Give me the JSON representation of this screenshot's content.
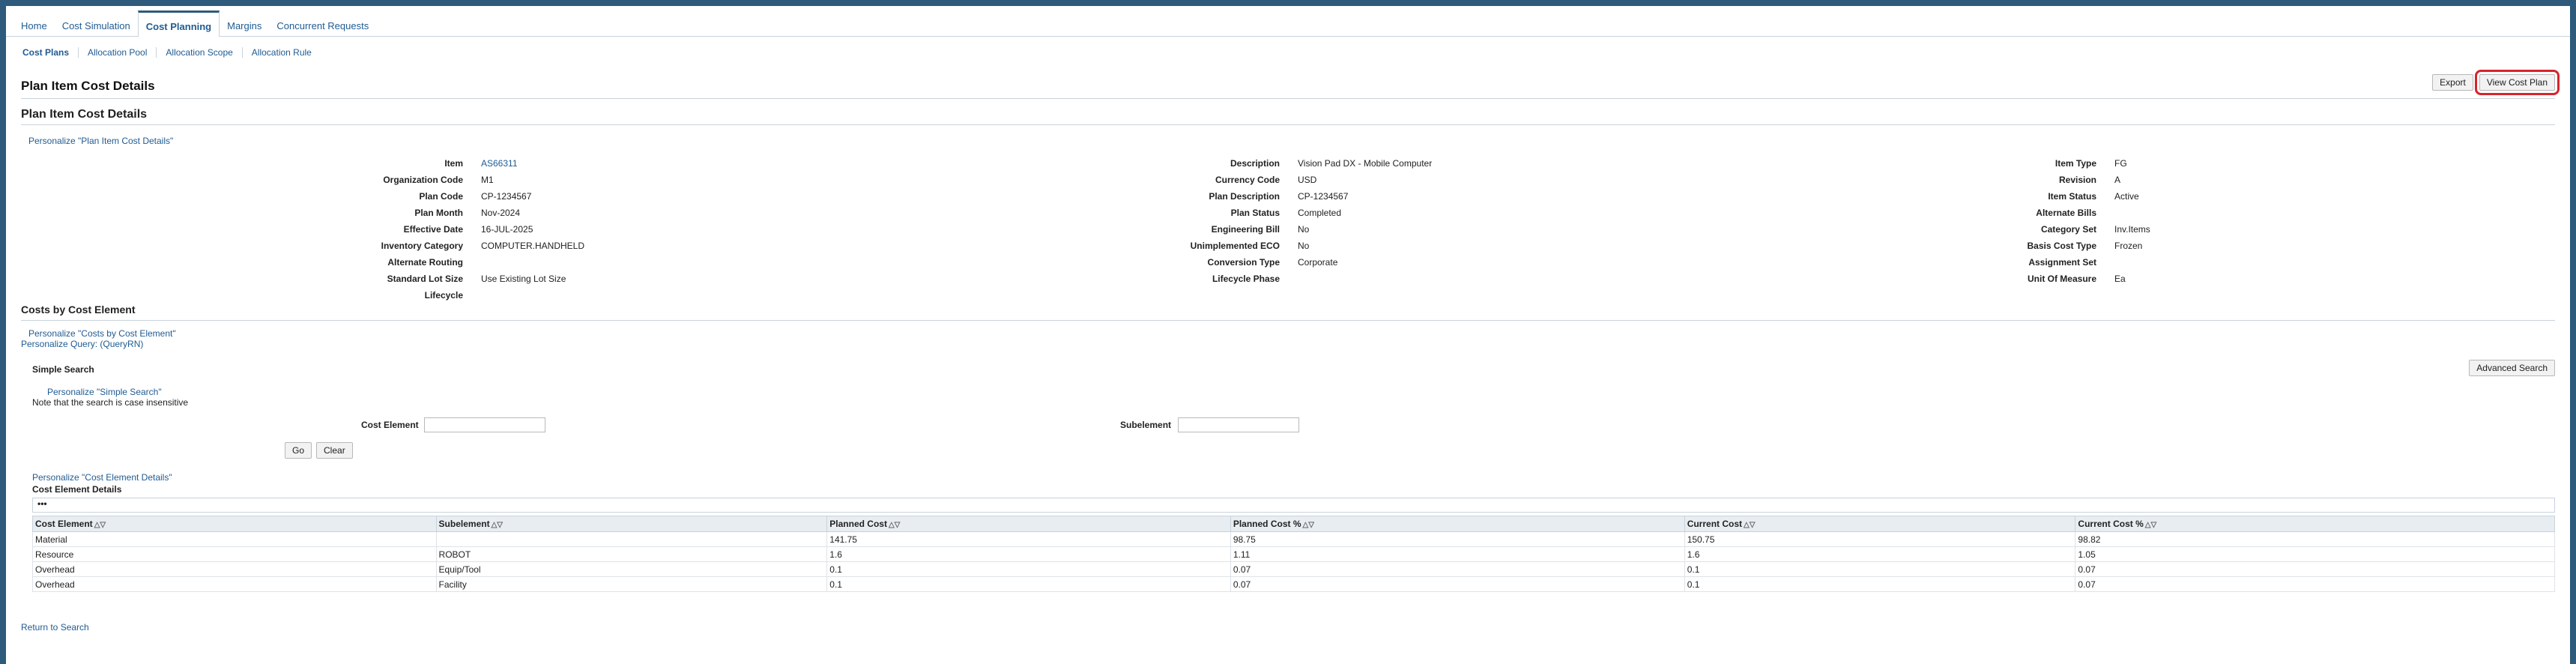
{
  "tabs": [
    "Home",
    "Cost Simulation",
    "Cost Planning",
    "Margins",
    "Concurrent Requests"
  ],
  "subtabs": [
    "Cost Plans",
    "Allocation Pool",
    "Allocation Scope",
    "Allocation Rule"
  ],
  "page": {
    "title": "Plan Item Cost Details",
    "export_label": "Export",
    "view_cost_plan_label": "View Cost Plan",
    "section_title": "Plan Item Cost Details",
    "personalize_details": "Personalize \"Plan Item Cost Details\""
  },
  "details": {
    "col1": [
      {
        "label": "Item",
        "value": "AS66311",
        "link": true
      },
      {
        "label": "Organization Code",
        "value": "M1"
      },
      {
        "label": "Plan Code",
        "value": "CP-1234567"
      },
      {
        "label": "Plan Month",
        "value": "Nov-2024"
      },
      {
        "label": "Effective Date",
        "value": "16-JUL-2025"
      },
      {
        "label": "Inventory Category",
        "value": "COMPUTER.HANDHELD"
      },
      {
        "label": "Alternate Routing",
        "value": ""
      },
      {
        "label": "Standard Lot Size",
        "value": "Use Existing Lot Size"
      },
      {
        "label": "Lifecycle",
        "value": ""
      }
    ],
    "col2": [
      {
        "label": "Description",
        "value": "Vision Pad DX - Mobile Computer"
      },
      {
        "label": "Currency Code",
        "value": "USD"
      },
      {
        "label": "Plan Description",
        "value": "CP-1234567"
      },
      {
        "label": "Plan Status",
        "value": "Completed"
      },
      {
        "label": "Engineering Bill",
        "value": "No"
      },
      {
        "label": "Unimplemented ECO",
        "value": "No"
      },
      {
        "label": "Conversion Type",
        "value": "Corporate"
      },
      {
        "label": "Lifecycle Phase",
        "value": ""
      }
    ],
    "col3": [
      {
        "label": "Item Type",
        "value": "FG"
      },
      {
        "label": "Revision",
        "value": "A"
      },
      {
        "label": "Item Status",
        "value": "Active"
      },
      {
        "label": "Alternate Bills",
        "value": ""
      },
      {
        "label": "Category Set",
        "value": "Inv.Items"
      },
      {
        "label": "Basis Cost Type",
        "value": "Frozen"
      },
      {
        "label": "Assignment Set",
        "value": ""
      },
      {
        "label": "Unit Of Measure",
        "value": "Ea"
      }
    ]
  },
  "costs": {
    "title": "Costs by Cost Element",
    "personalize": "Personalize \"Costs by Cost Element\"",
    "personalize_query": "Personalize Query: (QueryRN)",
    "simple_search": "Simple Search",
    "advanced_search_label": "Advanced Search",
    "personalize_search": "Personalize \"Simple Search\"",
    "note": "Note that the search is case insensitive",
    "cost_element_label": "Cost Element",
    "subelement_label": "Subelement",
    "cost_element_value": "",
    "subelement_value": "",
    "go_label": "Go",
    "clear_label": "Clear",
    "personalize_table": "Personalize \"Cost Element Details\"",
    "table_caption": "Cost Element Details",
    "dots": "•••",
    "columns": [
      "Cost Element",
      "Subelement",
      "Planned Cost",
      "Planned Cost %",
      "Current Cost",
      "Current Cost %"
    ],
    "rows": [
      [
        "Material",
        "",
        "141.75",
        "98.75",
        "150.75",
        "98.82"
      ],
      [
        "Resource",
        "ROBOT",
        "1.6",
        "1.11",
        "1.6",
        "1.05"
      ],
      [
        "Overhead",
        "Equip/Tool",
        "0.1",
        "0.07",
        "0.1",
        "0.07"
      ],
      [
        "Overhead",
        "Facility",
        "0.1",
        "0.07",
        "0.1",
        "0.07"
      ]
    ]
  },
  "return_label": "Return to Search"
}
